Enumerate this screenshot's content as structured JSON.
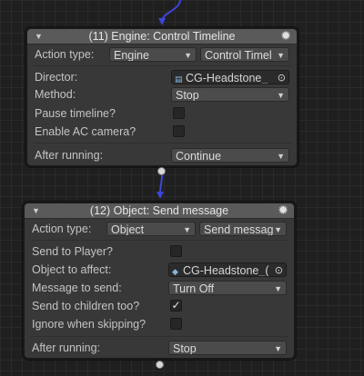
{
  "node1": {
    "title": "(11) Engine: Control Timeline",
    "fields": {
      "action_type_label": "Action type:",
      "action_type_value": "Engine",
      "action_subtype_value": "Control Timel",
      "director_label": "Director:",
      "director_value": "CG-Headstone_",
      "method_label": "Method:",
      "method_value": "Stop",
      "pause_label": "Pause timeline?",
      "enable_cam_label": "Enable AC camera?",
      "after_label": "After running:",
      "after_value": "Continue"
    },
    "checks": {
      "pause": false,
      "enable_cam": false
    }
  },
  "node2": {
    "title": "(12) Object: Send message",
    "fields": {
      "action_type_label": "Action type:",
      "action_type_value": "Object",
      "action_subtype_value": "Send messag",
      "send_player_label": "Send to Player?",
      "object_label": "Object to affect:",
      "object_value": "CG-Headstone_(",
      "message_label": "Message to send:",
      "message_value": "Turn Off",
      "children_label": "Send to children too?",
      "ignore_label": "Ignore when skipping?",
      "after_label": "After running:",
      "after_value": "Stop"
    },
    "checks": {
      "send_player": false,
      "children": true,
      "ignore": false
    }
  },
  "icons": {
    "fold": "▼",
    "gear": "✹",
    "arrow": "▼",
    "picker": "⊙",
    "director_icon": "▤",
    "object_icon": "◆",
    "check": "✓"
  },
  "colors": {
    "wire": "#3c46d6",
    "header": "#5a5a5a",
    "body": "#383838"
  }
}
